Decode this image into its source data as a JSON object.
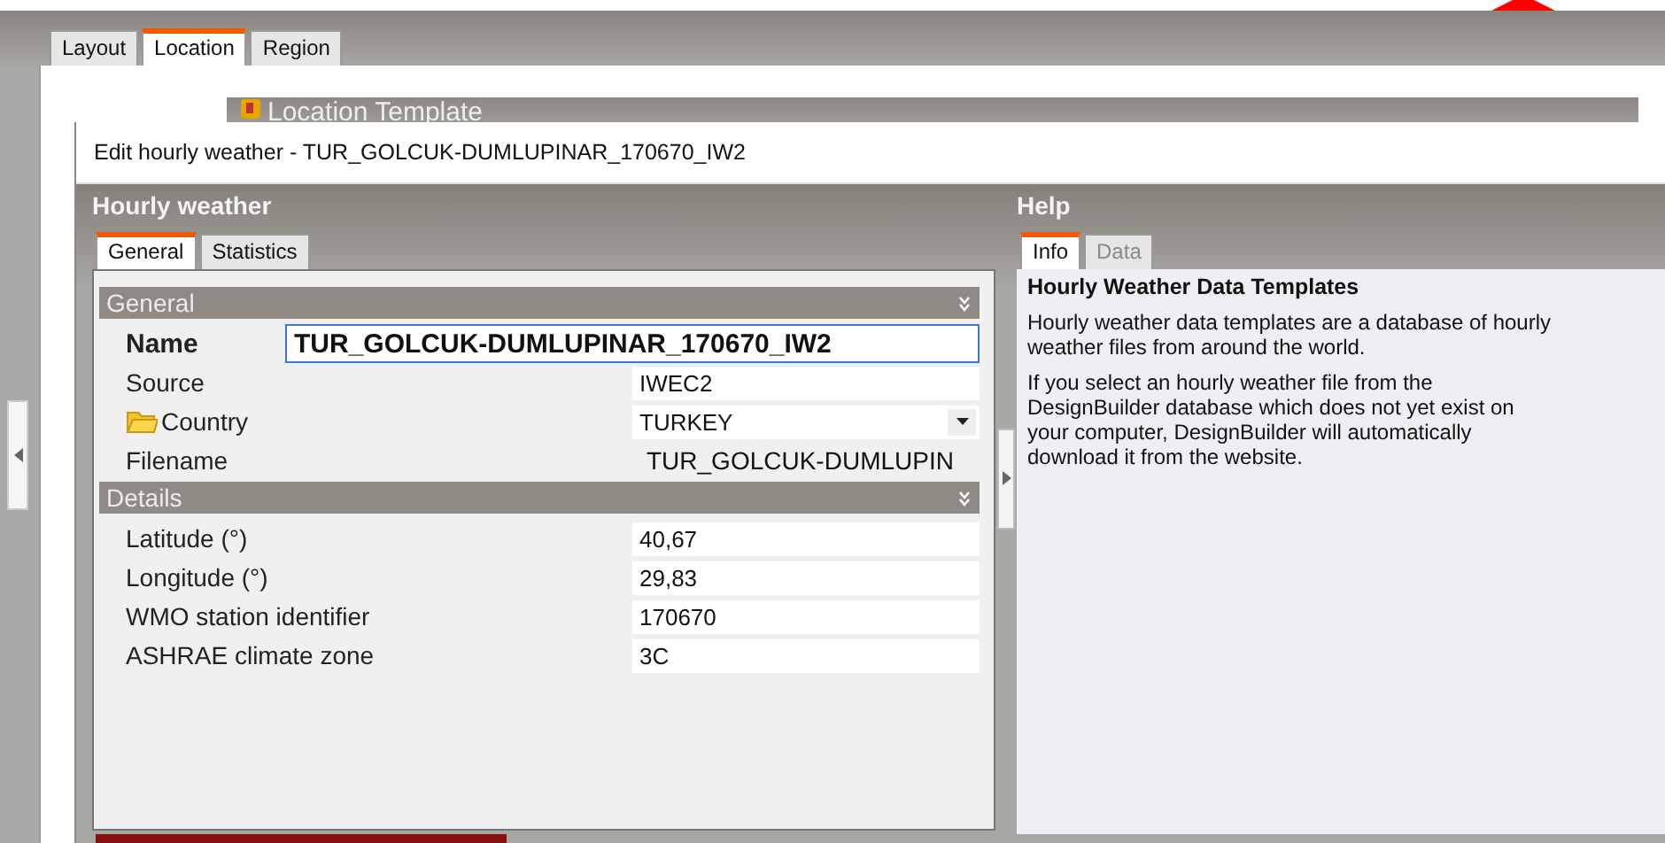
{
  "main_tabs": [
    {
      "label": "Layout",
      "selected": false
    },
    {
      "label": "Location",
      "selected": true
    },
    {
      "label": "Region",
      "selected": false
    }
  ],
  "template_bar": {
    "title": "Location Template"
  },
  "dialog": {
    "title": "Edit hourly weather - TUR_GOLCUK-DUMLUPINAR_170670_IW2",
    "left": {
      "header": "Hourly weather",
      "tabs": [
        {
          "label": "General",
          "selected": true
        },
        {
          "label": "Statistics",
          "selected": false
        }
      ],
      "sections": [
        {
          "title": "General",
          "rows": [
            {
              "kind": "name",
              "label": "Name",
              "value": "TUR_GOLCUK-DUMLUPINAR_170670_IW2"
            },
            {
              "kind": "field",
              "label": "Source",
              "value": "IWEC2"
            },
            {
              "kind": "dropdown",
              "label": "Country",
              "value": "TURKEY"
            },
            {
              "kind": "text",
              "label": "Filename",
              "value": "TUR_GOLCUK-DUMLUPIN"
            }
          ]
        },
        {
          "title": "Details",
          "rows": [
            {
              "kind": "field",
              "label": "Latitude (°)",
              "value": "40,67"
            },
            {
              "kind": "field",
              "label": "Longitude (°)",
              "value": "29,83"
            },
            {
              "kind": "field",
              "label": "WMO station identifier",
              "value": "170670"
            },
            {
              "kind": "field",
              "label": "ASHRAE climate zone",
              "value": "3C"
            }
          ]
        }
      ]
    },
    "help": {
      "header": "Help",
      "tabs": [
        {
          "label": "Info",
          "selected": true,
          "disabled": false
        },
        {
          "label": "Data",
          "selected": false,
          "disabled": true
        }
      ],
      "title": "Hourly Weather Data Templates",
      "paragraphs": [
        "Hourly weather data templates are a database of hourly weather files from around the world.",
        "If you select an hourly weather file from the DesignBuilder database which does not yet exist on your computer, DesignBuilder will automatically download it from the website."
      ]
    }
  }
}
